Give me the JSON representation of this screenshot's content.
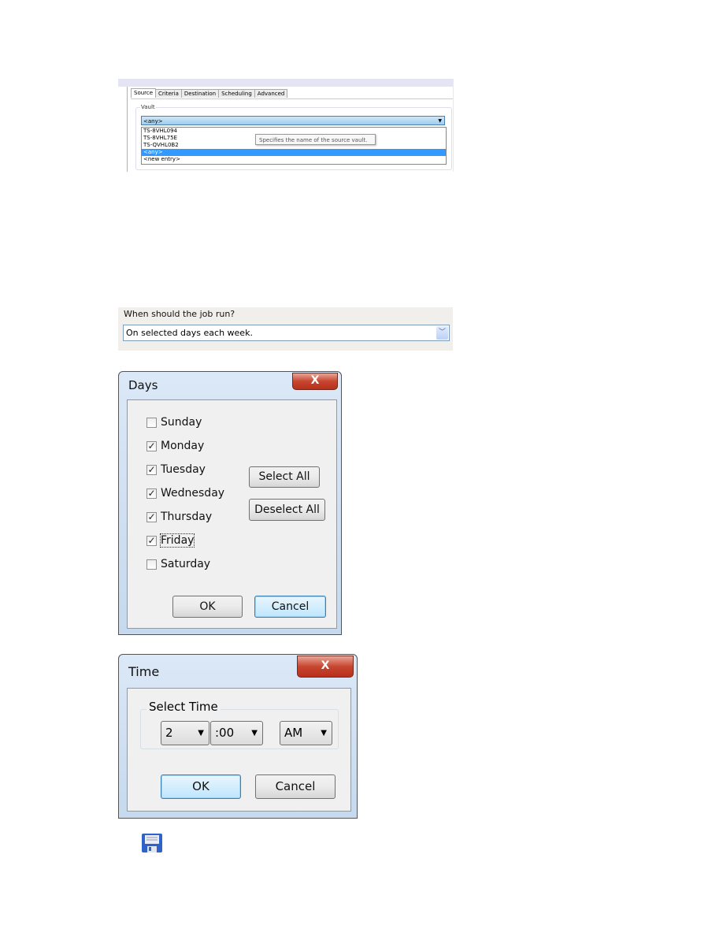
{
  "source_panel": {
    "tabs": [
      "Source",
      "Criteria",
      "Destination",
      "Scheduling",
      "Advanced"
    ],
    "selected_tab": "Source",
    "vault_label": "Vault",
    "vault_value": "<any>",
    "vault_options": [
      "TS-8VHL094",
      "TS-8VHL75E",
      "TS-QVHL0B2",
      "<any>",
      "<new entry>"
    ],
    "highlighted_option": "<any>",
    "tooltip": "Specifies the name of the source vault."
  },
  "schedule_panel": {
    "label": "When should the job run?",
    "value": "On selected days each week."
  },
  "days_dialog": {
    "title": "Days",
    "close": "X",
    "days": [
      {
        "label": "Sunday",
        "checked": false
      },
      {
        "label": "Monday",
        "checked": true
      },
      {
        "label": "Tuesday",
        "checked": true
      },
      {
        "label": "Wednesday",
        "checked": true
      },
      {
        "label": "Thursday",
        "checked": true
      },
      {
        "label": "Friday",
        "checked": true
      },
      {
        "label": "Saturday",
        "checked": false
      }
    ],
    "select_all": "Select All",
    "deselect_all": "Deselect All",
    "ok": "OK",
    "cancel": "Cancel"
  },
  "time_dialog": {
    "title": "Time",
    "close": "X",
    "group_label": "Select Time",
    "hour": "2",
    "minute": ":00",
    "ampm": "AM",
    "ok": "OK",
    "cancel": "Cancel"
  },
  "icons": {
    "save": "floppy-disk-icon"
  }
}
